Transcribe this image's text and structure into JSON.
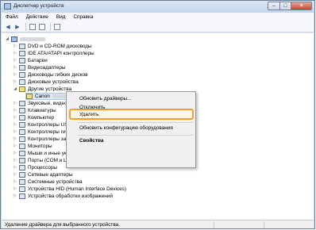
{
  "window": {
    "title": "Диспетчер устройств",
    "close_glyph": "×",
    "max_glyph": "□",
    "min_glyph": "–"
  },
  "menu": [
    "Файл",
    "Действие",
    "Вид",
    "Справка"
  ],
  "toolbar": {
    "icons": [
      "back-arrow-icon",
      "forward-arrow-icon",
      "properties-icon",
      "help-icon",
      "scan-hardware-icon"
    ],
    "back_glyph": "◀",
    "forward_glyph": "▶"
  },
  "tree": {
    "expander_open": "◢",
    "expander_closed": "▷",
    "root_label": "",
    "items": [
      "DVD и CD-ROM дисководы",
      "IDE ATA/ATAPI контроллеры",
      "Батареи",
      "Видеоадаптеры",
      "Дисководы гибких дисков",
      "Дисковые устройства",
      "Другие устройства",
      "Canon",
      "Звуковые, видео",
      "Клавиатуры",
      "Компьютер",
      "Контроллеры USB",
      "Контроллеры гиб",
      "Контроллеры запо",
      "Мониторы",
      "Мыши и иные указывающие устройства",
      "Порты (COM и LPT)",
      "Процессоры",
      "Сетевые адаптеры",
      "Системные устройства",
      "Устройства HID (Human Interface Devices)",
      "Устройства обработки изображений"
    ]
  },
  "context_menu": {
    "update_drivers": "Обновить драйверы...",
    "disable": "Отключить",
    "uninstall": "Удалить",
    "scan_hardware": "Обновить конфигурацию оборудования",
    "properties": "Свойства"
  },
  "status_bar": {
    "text": "Удаление драйвера для выбранного устройства."
  },
  "colors": {
    "highlight_outline": "#f0a030",
    "title_bar": "#c4d5ea"
  }
}
